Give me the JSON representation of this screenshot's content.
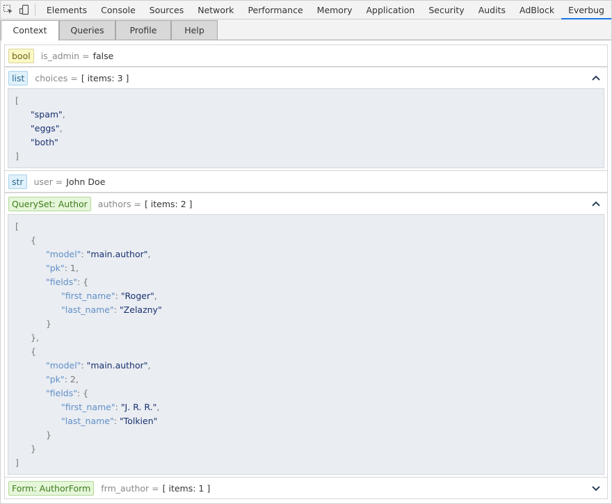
{
  "devtools": {
    "tabs": [
      "Elements",
      "Console",
      "Sources",
      "Network",
      "Performance",
      "Memory",
      "Application",
      "Security",
      "Audits",
      "AdBlock",
      "Everbug"
    ],
    "active_tab": "Everbug",
    "accent": "#1a73e8"
  },
  "panel_tabs": [
    "Context",
    "Queries",
    "Profile",
    "Help"
  ],
  "active_panel_tab": "Context",
  "vars": {
    "is_admin": {
      "type": "bool",
      "name": "is_admin =",
      "value": "false"
    },
    "choices": {
      "type": "list",
      "name": "choices =",
      "value": "[ items: 3 ]",
      "lines": [
        {
          "indent": 0,
          "tokens": [
            {
              "c": "p",
              "t": "["
            }
          ]
        },
        {
          "indent": 1,
          "tokens": [
            {
              "c": "s",
              "t": "\"spam\""
            },
            {
              "c": "p",
              "t": ","
            }
          ]
        },
        {
          "indent": 1,
          "tokens": [
            {
              "c": "s",
              "t": "\"eggs\""
            },
            {
              "c": "p",
              "t": ","
            }
          ]
        },
        {
          "indent": 1,
          "tokens": [
            {
              "c": "s",
              "t": "\"both\""
            }
          ]
        },
        {
          "indent": 0,
          "tokens": [
            {
              "c": "p",
              "t": "]"
            }
          ]
        }
      ]
    },
    "user": {
      "type": "str",
      "name": "user =",
      "value": "John Doe"
    },
    "authors": {
      "type": "QuerySet: Author",
      "name": "authors =",
      "value": "[ items: 2 ]",
      "lines": [
        {
          "indent": 0,
          "tokens": [
            {
              "c": "p",
              "t": "["
            }
          ]
        },
        {
          "indent": 1,
          "tokens": [
            {
              "c": "p",
              "t": "{"
            }
          ]
        },
        {
          "indent": 2,
          "tokens": [
            {
              "c": "k",
              "t": "\"model\""
            },
            {
              "c": "p",
              "t": ": "
            },
            {
              "c": "s",
              "t": "\"main.author\""
            },
            {
              "c": "p",
              "t": ","
            }
          ]
        },
        {
          "indent": 2,
          "tokens": [
            {
              "c": "k",
              "t": "\"pk\""
            },
            {
              "c": "p",
              "t": ": 1,"
            }
          ]
        },
        {
          "indent": 2,
          "tokens": [
            {
              "c": "k",
              "t": "\"fields\""
            },
            {
              "c": "p",
              "t": ": {"
            }
          ]
        },
        {
          "indent": 3,
          "tokens": [
            {
              "c": "k",
              "t": "\"first_name\""
            },
            {
              "c": "p",
              "t": ": "
            },
            {
              "c": "s",
              "t": "\"Roger\""
            },
            {
              "c": "p",
              "t": ","
            }
          ]
        },
        {
          "indent": 3,
          "tokens": [
            {
              "c": "k",
              "t": "\"last_name\""
            },
            {
              "c": "p",
              "t": ": "
            },
            {
              "c": "s",
              "t": "\"Zelazny\""
            }
          ]
        },
        {
          "indent": 2,
          "tokens": [
            {
              "c": "p",
              "t": "}"
            }
          ]
        },
        {
          "indent": 1,
          "tokens": [
            {
              "c": "p",
              "t": "},"
            }
          ]
        },
        {
          "indent": 1,
          "tokens": [
            {
              "c": "p",
              "t": "{"
            }
          ]
        },
        {
          "indent": 2,
          "tokens": [
            {
              "c": "k",
              "t": "\"model\""
            },
            {
              "c": "p",
              "t": ": "
            },
            {
              "c": "s",
              "t": "\"main.author\""
            },
            {
              "c": "p",
              "t": ","
            }
          ]
        },
        {
          "indent": 2,
          "tokens": [
            {
              "c": "k",
              "t": "\"pk\""
            },
            {
              "c": "p",
              "t": ": 2,"
            }
          ]
        },
        {
          "indent": 2,
          "tokens": [
            {
              "c": "k",
              "t": "\"fields\""
            },
            {
              "c": "p",
              "t": ": {"
            }
          ]
        },
        {
          "indent": 3,
          "tokens": [
            {
              "c": "k",
              "t": "\"first_name\""
            },
            {
              "c": "p",
              "t": ": "
            },
            {
              "c": "s",
              "t": "\"J. R. R.\""
            },
            {
              "c": "p",
              "t": ","
            }
          ]
        },
        {
          "indent": 3,
          "tokens": [
            {
              "c": "k",
              "t": "\"last_name\""
            },
            {
              "c": "p",
              "t": ": "
            },
            {
              "c": "s",
              "t": "\"Tolkien\""
            }
          ]
        },
        {
          "indent": 2,
          "tokens": [
            {
              "c": "p",
              "t": "}"
            }
          ]
        },
        {
          "indent": 1,
          "tokens": [
            {
              "c": "p",
              "t": "}"
            }
          ]
        },
        {
          "indent": 0,
          "tokens": [
            {
              "c": "p",
              "t": "]"
            }
          ]
        }
      ]
    },
    "frm_author": {
      "type": "Form: AuthorForm",
      "name": "frm_author =",
      "value": "[ items: 1 ]"
    }
  },
  "icons": {
    "inspect": "inspect-element-icon",
    "device": "device-toolbar-icon",
    "collapse": "chevron-up-icon",
    "expand": "chevron-down-icon"
  }
}
